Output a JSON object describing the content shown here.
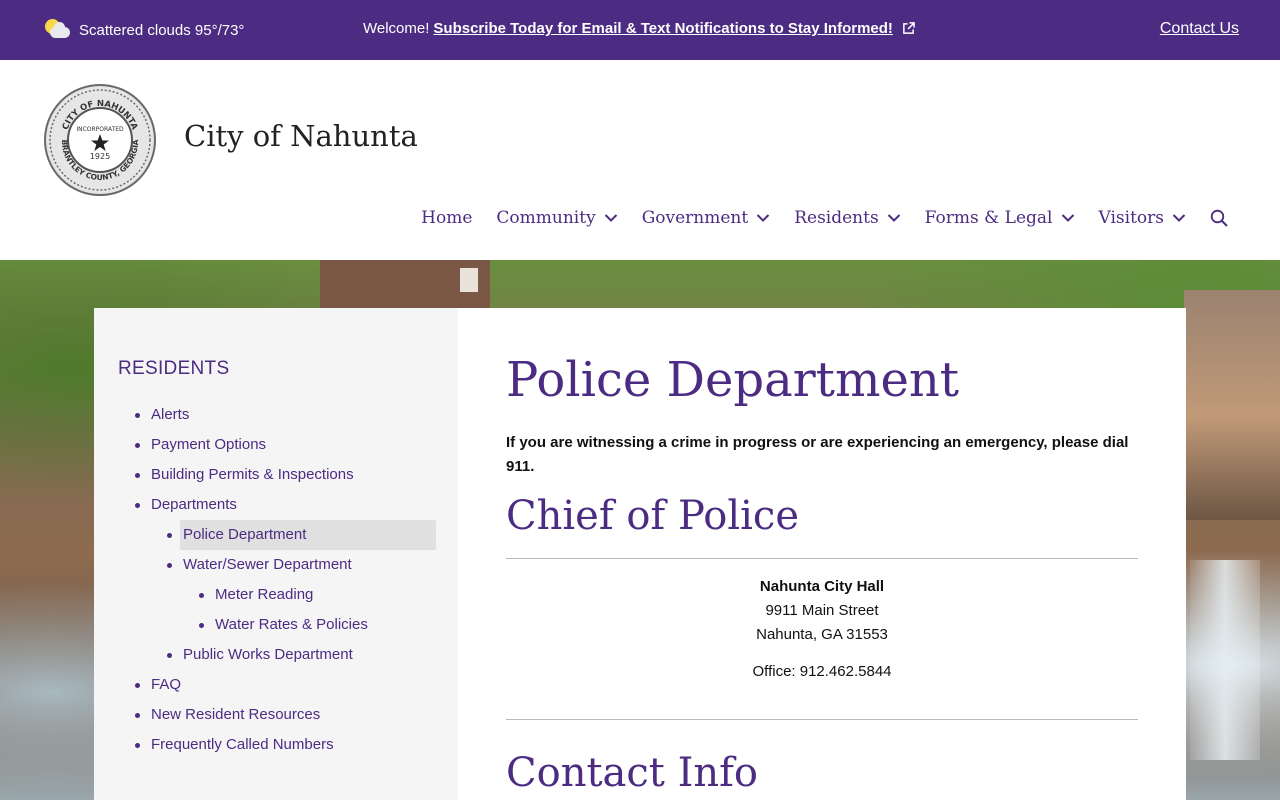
{
  "topbar": {
    "weather": "Scattered clouds 95°/73°",
    "welcome_prefix": "Welcome!",
    "subscribe_link": "Subscribe Today for Email & Text Notifications to Stay Informed!",
    "contact_link": "Contact Us"
  },
  "header": {
    "site_title": "City of Nahunta",
    "seal_text": {
      "top": "CITY OF NAHUNTA",
      "bottom": "BRANTLEY COUNTY, GEORGIA",
      "incorporated": "INCORPORATED",
      "year": "1925"
    },
    "nav": [
      "Home",
      "Community",
      "Government",
      "Residents",
      "Forms & Legal",
      "Visitors"
    ]
  },
  "sidebar": {
    "heading": "RESIDENTS",
    "items": [
      {
        "label": "Alerts",
        "level": 0
      },
      {
        "label": "Payment Options",
        "level": 0
      },
      {
        "label": "Building Permits & Inspections",
        "level": 0
      },
      {
        "label": "Departments",
        "level": 0
      },
      {
        "label": "Police Department",
        "level": 1,
        "active": true
      },
      {
        "label": "Water/Sewer Department",
        "level": 1
      },
      {
        "label": "Meter Reading",
        "level": 2
      },
      {
        "label": "Water Rates & Policies",
        "level": 2
      },
      {
        "label": "Public Works Department",
        "level": 1
      },
      {
        "label": "FAQ",
        "level": 0
      },
      {
        "label": "New Resident Resources",
        "level": 0
      },
      {
        "label": "Frequently Called Numbers",
        "level": 0
      }
    ]
  },
  "main": {
    "title": "Police Department",
    "emergency_note": "If you are witnessing a crime in progress or are experiencing an emergency, please dial 911.",
    "chief_heading": "Chief of Police",
    "address": {
      "name": "Nahunta City Hall",
      "street": "9911 Main Street",
      "city": "Nahunta, GA 31553"
    },
    "office_phone": "Office: 912.462.5844",
    "contact_heading": "Contact Info"
  },
  "colors": {
    "brand_purple": "#4b2c82",
    "sidebar_bg": "#f5f5f5",
    "active_item_bg": "#e0e0e0"
  }
}
